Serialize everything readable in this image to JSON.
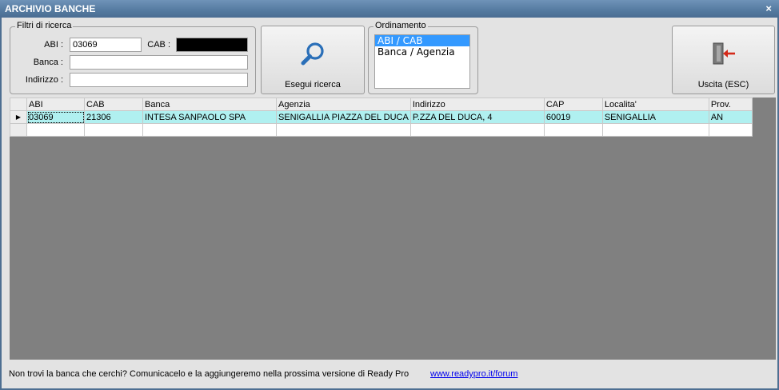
{
  "window": {
    "title": "ARCHIVIO BANCHE",
    "close": "×"
  },
  "filters": {
    "legend": "Filtri di ricerca",
    "abi_label": "ABI :",
    "abi_value": "03069",
    "cab_label": "CAB :",
    "cab_value": "",
    "banca_label": "Banca :",
    "banca_value": "",
    "indirizzo_label": "Indirizzo :",
    "indirizzo_value": ""
  },
  "search_button": {
    "label": "Esegui ricerca",
    "icon": "magnifier-icon"
  },
  "ordering": {
    "legend": "Ordinamento",
    "options": [
      {
        "label": "ABI / CAB",
        "selected": true
      },
      {
        "label": "Banca / Agenzia",
        "selected": false
      }
    ]
  },
  "exit_button": {
    "label": "Uscita (ESC)",
    "icon": "exit-door-icon"
  },
  "grid": {
    "columns": [
      "ABI",
      "CAB",
      "Banca",
      "Agenzia",
      "Indirizzo",
      "CAP",
      "Localita'",
      "Prov."
    ],
    "rows": [
      [
        "03069",
        "21306",
        "INTESA SANPAOLO SPA",
        "SENIGALLIA PIAZZA DEL DUCA",
        "P.ZZA DEL DUCA, 4",
        "60019",
        "SENIGALLIA",
        "AN"
      ]
    ],
    "current_row_marker": "▶"
  },
  "footer": {
    "message": "Non trovi la banca che cerchi? Comunicacelo e la aggiungeremo nella prossima versione di Ready Pro",
    "link": "www.readypro.it/forum"
  }
}
